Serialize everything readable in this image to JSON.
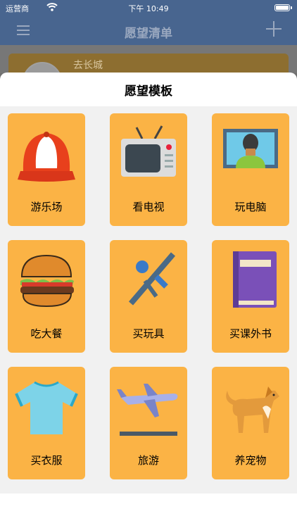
{
  "status_bar": {
    "carrier": "运营商",
    "time": "下午 10:49"
  },
  "nav": {
    "title": "愿望清单"
  },
  "background_card": {
    "name": "去长城"
  },
  "sheet": {
    "title": "愿望模板",
    "templates": [
      {
        "label": "游乐场",
        "icon": "cap-icon"
      },
      {
        "label": "看电视",
        "icon": "tv-icon"
      },
      {
        "label": "玩电脑",
        "icon": "computer-icon"
      },
      {
        "label": "吃大餐",
        "icon": "burger-icon"
      },
      {
        "label": "买玩具",
        "icon": "toy-gun-icon"
      },
      {
        "label": "买课外书",
        "icon": "book-icon"
      },
      {
        "label": "买衣服",
        "icon": "tshirt-icon"
      },
      {
        "label": "旅游",
        "icon": "airplane-icon"
      },
      {
        "label": "养宠物",
        "icon": "dog-icon"
      }
    ]
  },
  "colors": {
    "tile": "#fbb345",
    "nav": "#48658f",
    "sheet_bg": "#f1f1f1"
  }
}
